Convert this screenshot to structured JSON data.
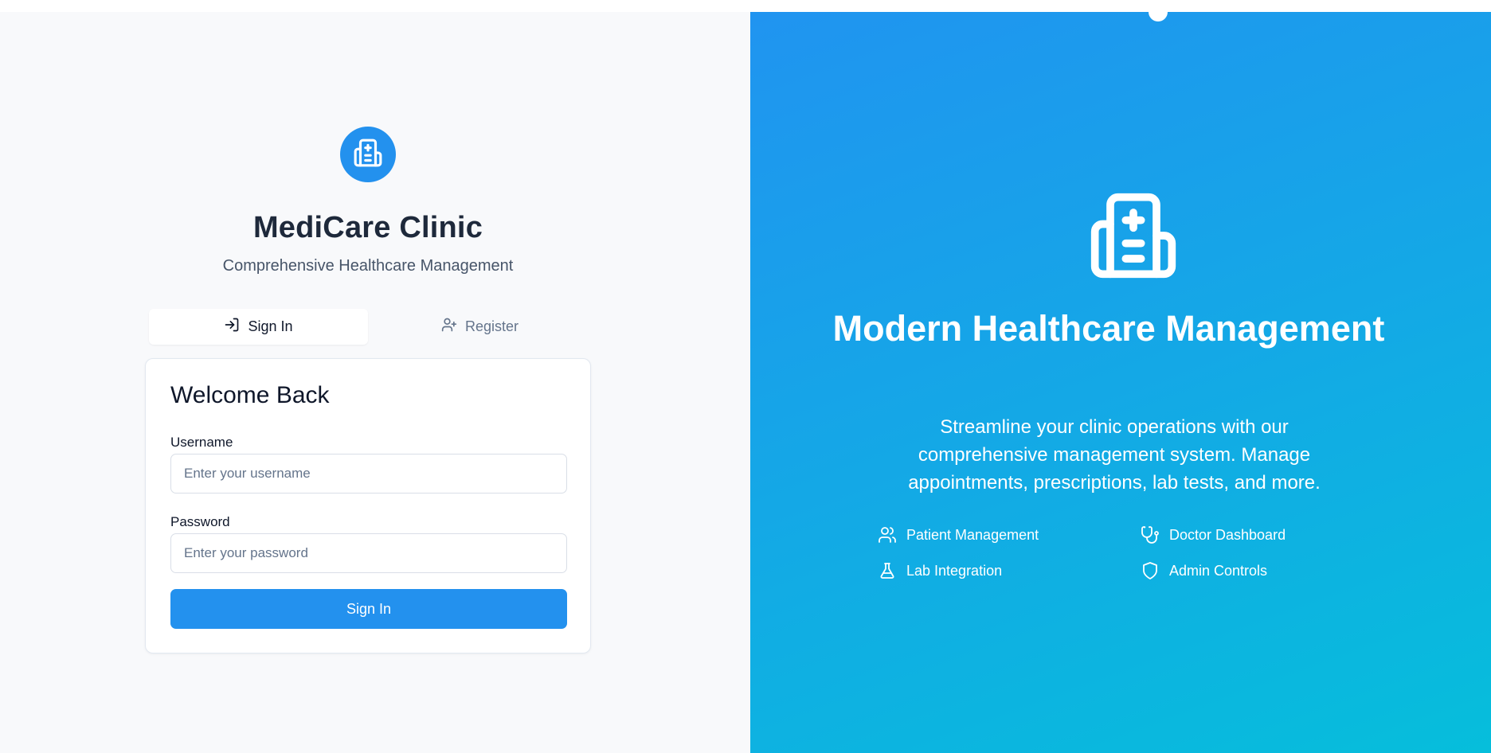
{
  "brand": {
    "icon": "hospital-icon",
    "title": "MediCare Clinic",
    "subtitle": "Comprehensive Healthcare Management",
    "accent_color": "#2391ee"
  },
  "tabs": [
    {
      "label": "Sign In",
      "icon": "sign-in-icon",
      "active": true
    },
    {
      "label": "Register",
      "icon": "user-plus-icon",
      "active": false
    }
  ],
  "form": {
    "title": "Welcome Back",
    "username_label": "Username",
    "username_placeholder": "Enter your username",
    "username_value": "",
    "password_label": "Password",
    "password_placeholder": "Enter your password",
    "password_value": "",
    "submit_label": "Sign In"
  },
  "hero": {
    "icon": "hospital-icon",
    "title": "Modern Healthcare Management",
    "description": "Streamline your clinic operations with our comprehensive management system. Manage appointments, prescriptions, lab tests, and more.",
    "gradient_start": "#2094f0",
    "gradient_end": "#06bedb",
    "features": [
      {
        "label": "Patient Management",
        "icon": "users-icon"
      },
      {
        "label": "Doctor Dashboard",
        "icon": "stethoscope-icon"
      },
      {
        "label": "Lab Integration",
        "icon": "flask-icon"
      },
      {
        "label": "Admin Controls",
        "icon": "shield-icon"
      }
    ]
  }
}
